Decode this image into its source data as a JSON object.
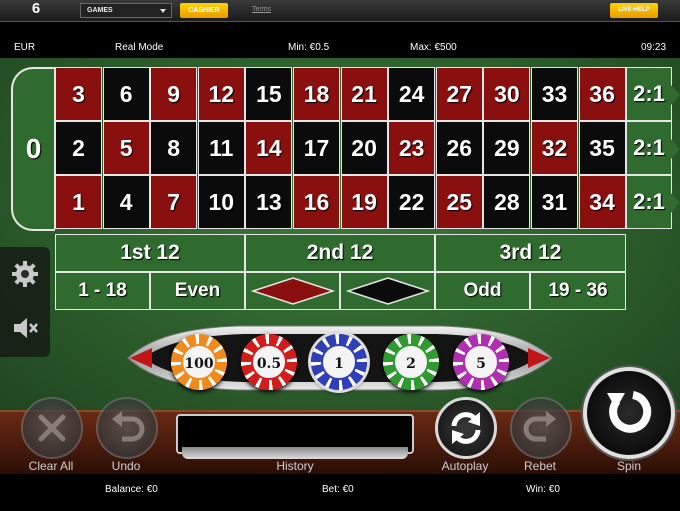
{
  "topbar": {
    "logo_number": "6",
    "logo_sub": "CASINO",
    "games_select_value": "GAMES",
    "cashier_label": "CASHIER",
    "terms_label": "Terms",
    "livehelp_label": "LIVE-HELP"
  },
  "info": {
    "currency": "EUR",
    "mode": "Real Mode",
    "min": "Min: €0.5",
    "max": "Max: €500",
    "time": "09:23"
  },
  "table": {
    "zero": "0",
    "rows": [
      [
        {
          "n": "3",
          "c": "red"
        },
        {
          "n": "6",
          "c": "black"
        },
        {
          "n": "9",
          "c": "red"
        },
        {
          "n": "12",
          "c": "red"
        },
        {
          "n": "15",
          "c": "black"
        },
        {
          "n": "18",
          "c": "red"
        },
        {
          "n": "21",
          "c": "red"
        },
        {
          "n": "24",
          "c": "black"
        },
        {
          "n": "27",
          "c": "red"
        },
        {
          "n": "30",
          "c": "red"
        },
        {
          "n": "33",
          "c": "black"
        },
        {
          "n": "36",
          "c": "red"
        }
      ],
      [
        {
          "n": "2",
          "c": "black"
        },
        {
          "n": "5",
          "c": "red"
        },
        {
          "n": "8",
          "c": "black"
        },
        {
          "n": "11",
          "c": "black"
        },
        {
          "n": "14",
          "c": "red"
        },
        {
          "n": "17",
          "c": "black"
        },
        {
          "n": "20",
          "c": "black"
        },
        {
          "n": "23",
          "c": "red"
        },
        {
          "n": "26",
          "c": "black"
        },
        {
          "n": "29",
          "c": "black"
        },
        {
          "n": "32",
          "c": "red"
        },
        {
          "n": "35",
          "c": "black"
        }
      ],
      [
        {
          "n": "1",
          "c": "red"
        },
        {
          "n": "4",
          "c": "black"
        },
        {
          "n": "7",
          "c": "red"
        },
        {
          "n": "10",
          "c": "black"
        },
        {
          "n": "13",
          "c": "black"
        },
        {
          "n": "16",
          "c": "red"
        },
        {
          "n": "19",
          "c": "red"
        },
        {
          "n": "22",
          "c": "black"
        },
        {
          "n": "25",
          "c": "red"
        },
        {
          "n": "28",
          "c": "black"
        },
        {
          "n": "31",
          "c": "black"
        },
        {
          "n": "34",
          "c": "red"
        }
      ]
    ],
    "column_bets": [
      "2:1",
      "2:1",
      "2:1"
    ],
    "dozens": [
      "1st 12",
      "2nd 12",
      "3rd 12"
    ],
    "low": "1 - 18",
    "even": "Even",
    "odd": "Odd",
    "high": "19 - 36",
    "colors": {
      "red": "#8a0f0f",
      "black": "#0b0b0b",
      "felt": "#2f6b2e"
    }
  },
  "chips": [
    {
      "value": "100",
      "color": "#f08a1c"
    },
    {
      "value": "0.5",
      "color": "#d31d1d"
    },
    {
      "value": "1",
      "color": "#2f3fb8"
    },
    {
      "value": "2",
      "color": "#2f9a2f"
    },
    {
      "value": "5",
      "color": "#b02fb0"
    }
  ],
  "controls": {
    "clear_all": "Clear All",
    "undo": "Undo",
    "history": "History",
    "autoplay": "Autoplay",
    "rebet": "Rebet",
    "spin": "Spin"
  },
  "footer": {
    "balance": "Balance: €0",
    "bet": "Bet: €0",
    "win": "Win: €0"
  }
}
